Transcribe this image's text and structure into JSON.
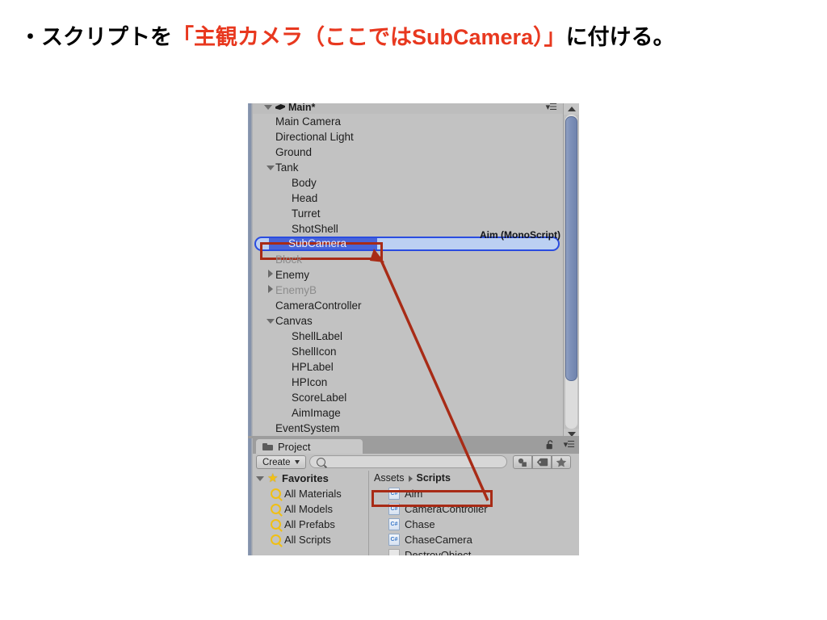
{
  "slide": {
    "bullet": "・スクリプトを",
    "highlight": "「主観カメラ（ここではSubCamera）」",
    "tail": "に付ける。"
  },
  "colors": {
    "highlight_red": "#e8381f",
    "annotation_red": "#a82b16",
    "drag_border_blue": "#2a4ce0",
    "drag_fill_blue": "#bcd0f2",
    "selection_blue": "#4864d8",
    "panel_gray": "#c2c2c2",
    "scrollbar_blue": "#7f92ba",
    "favorite_yellow": "#f0bf14"
  },
  "hierarchy": {
    "scene_name": "Main*",
    "menu_icon": "panel-menu-icon",
    "scene_icon": "unity-scene-icon",
    "items": [
      {
        "label": "Main Camera",
        "indent": 1,
        "arrow": "none",
        "dim": false
      },
      {
        "label": "Directional Light",
        "indent": 1,
        "arrow": "none",
        "dim": false
      },
      {
        "label": "Ground",
        "indent": 1,
        "arrow": "none",
        "dim": false
      },
      {
        "label": "Tank",
        "indent": 1,
        "arrow": "open",
        "dim": false
      },
      {
        "label": "Body",
        "indent": 2,
        "arrow": "none",
        "dim": false
      },
      {
        "label": "Head",
        "indent": 2,
        "arrow": "none",
        "dim": false
      },
      {
        "label": "Turret",
        "indent": 2,
        "arrow": "none",
        "dim": false
      },
      {
        "label": "ShotShell",
        "indent": 2,
        "arrow": "none",
        "dim": false
      }
    ],
    "drag_target": {
      "label": "SubCamera",
      "drag_payload_label": "Aim (MonoScript)"
    },
    "items_after": [
      {
        "label": "Block",
        "indent": 1,
        "arrow": "none",
        "dim": true
      },
      {
        "label": "Enemy",
        "indent": 1,
        "arrow": "closed",
        "dim": false
      },
      {
        "label": "EnemyB",
        "indent": 1,
        "arrow": "closed",
        "dim": true
      },
      {
        "label": "CameraController",
        "indent": 1,
        "arrow": "none",
        "dim": false
      },
      {
        "label": "Canvas",
        "indent": 1,
        "arrow": "open",
        "dim": false
      },
      {
        "label": "ShellLabel",
        "indent": 2,
        "arrow": "none",
        "dim": false
      },
      {
        "label": "ShellIcon",
        "indent": 2,
        "arrow": "none",
        "dim": false
      },
      {
        "label": "HPLabel",
        "indent": 2,
        "arrow": "none",
        "dim": false
      },
      {
        "label": "HPIcon",
        "indent": 2,
        "arrow": "none",
        "dim": false
      },
      {
        "label": "ScoreLabel",
        "indent": 2,
        "arrow": "none",
        "dim": false
      },
      {
        "label": "AimImage",
        "indent": 2,
        "arrow": "none",
        "dim": false
      },
      {
        "label": "EventSystem",
        "indent": 1,
        "arrow": "none",
        "dim": false
      }
    ]
  },
  "project": {
    "tab_label": "Project",
    "tab_icon": "folder-icon",
    "lock_icon": "lock-open-icon",
    "menu_icon": "panel-menu-icon",
    "create_label": "Create",
    "search_placeholder": "",
    "search_value": "",
    "search_icon": "search-icon",
    "toolbar_buttons": [
      {
        "name": "filter-by-type-button",
        "icon": "shapes-icon"
      },
      {
        "name": "filter-by-label-button",
        "icon": "tag-icon"
      },
      {
        "name": "favorites-button",
        "icon": "star-icon"
      }
    ],
    "favorites": {
      "header": "Favorites",
      "header_icon": "star-icon",
      "items": [
        {
          "label": "All Materials"
        },
        {
          "label": "All Models"
        },
        {
          "label": "All Prefabs"
        },
        {
          "label": "All Scripts"
        }
      ]
    },
    "breadcrumb": {
      "root": "Assets",
      "current": "Scripts"
    },
    "assets": [
      {
        "label": "Aim",
        "icon": "csharp-script-icon",
        "selected": true
      },
      {
        "label": "CameraController",
        "icon": "csharp-script-icon",
        "selected": false
      },
      {
        "label": "Chase",
        "icon": "csharp-script-icon",
        "selected": false
      },
      {
        "label": "ChaseCamera",
        "icon": "csharp-script-icon",
        "selected": false
      },
      {
        "label": "DestroyObject",
        "icon": "file-icon",
        "selected": false
      }
    ]
  }
}
